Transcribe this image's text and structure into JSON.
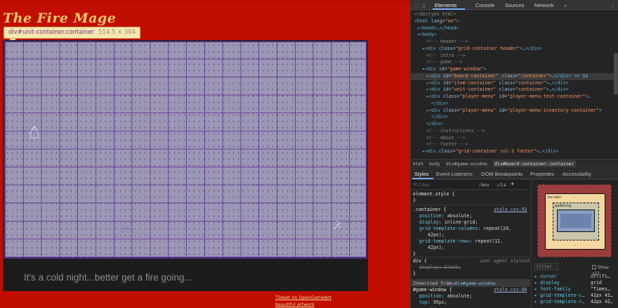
{
  "page": {
    "title": "The Fire Mage",
    "tooltip": {
      "selector": "div#unit-container.container",
      "dims": "514.5 × 304"
    },
    "message": "It's a cold night...better get a fire going...",
    "footer_left": "",
    "footer_right_line1_prefix": "",
    "footer_right_link1": "Tileset on OpenGameArt",
    "footer_right_link2": "beautiful artwork"
  },
  "devtools": {
    "tabs": [
      "Elements",
      "Console",
      "Sources",
      "Network"
    ],
    "active_tab": "Elements",
    "icons": [
      "inspect-icon",
      "device-icon",
      "more-tabs-icon",
      "kebab-icon"
    ],
    "dom": {
      "line1": "<!doctype html>",
      "line2_tag": "<html",
      "line2_attr": " lang=",
      "line2_val": "\"en\"",
      "line2_end": ">",
      "line3": "▸<head>…</head>",
      "line4": "▾<body>",
      "c_header": "<!-- header -->",
      "div1_pre": "▸<div ",
      "div1_attr": "class=",
      "div1_val": "\"grid-container header\"",
      "div1_end": ">…</div>",
      "c_intro": "<!-- intro -->",
      "c_game": "<!-- game -->",
      "gw_pre": "▾<div ",
      "gw_attr": "id=",
      "gw_val": "\"game-window\"",
      "gw_end": ">",
      "board_pre": "▸<div ",
      "board_attr1": "id=",
      "board_val1": "\"board-container\"",
      "board_attr2": " class=",
      "board_val2": "\"container\"",
      "board_end": ">…</div> == $0",
      "item_pre": "▸<div ",
      "item_attr1": "id=",
      "item_val1": "\"item-container\"",
      "item_attr2": " class=",
      "item_val2": "\"container\"",
      "item_end": ">…</div>",
      "unit_pre": "▸<div ",
      "unit_attr1": "id=",
      "unit_val1": "\"unit-container\"",
      "unit_attr2": " class=",
      "unit_val2": "\"container\"",
      "unit_end": ">…</div>",
      "pm1_pre": "▸<div ",
      "pm1_attr1": "class=",
      "pm1_val1": "\"player-menu\"",
      "pm1_attr2": " id=",
      "pm1_val2": "\"player-menu-text-container\"",
      "pm1_end": ">…",
      "close_div1": "</div>",
      "pm2_pre": "▸<div ",
      "pm2_attr1": "class=",
      "pm2_val1": "\"player-menu\"",
      "pm2_attr2": " id=",
      "pm2_val2": "\"player-menu-inventory-container\"",
      "pm2_end": ">",
      "close_div2": "</div>",
      "close_div3": "</div>",
      "c_instructions": "<!-- instructions -->",
      "c_about": "<!-- about -->",
      "c_footer": "<!-- footer -->",
      "foot_pre": "▸<div ",
      "foot_attr": "class=",
      "foot_val": "\"grid-container col-3 footer\"",
      "foot_end": ">…</div>"
    },
    "breadcrumbs": [
      "html",
      "body",
      "div#game-window",
      "div#board-container.container"
    ],
    "subtabs": [
      "Styles",
      "Event Listeners",
      "DOM Breakpoints",
      "Properties",
      "Accessibility"
    ],
    "filter": {
      "placeholder": "Filter",
      "hov": ":hov",
      "cls": ".cls",
      "plus": "+"
    },
    "styles": {
      "element_style": "element.style {",
      "close": "}",
      "container_sel": ".container {",
      "container_src": "style.css:92",
      "p1": "position",
      "v1": "absolute;",
      "p2": "display",
      "v2": "inline-grid;",
      "p3": "grid-template-columns",
      "v3": "repeat(20,",
      "v3b": "42px);",
      "p4": "grid-template-rows",
      "v4": "repeat(12,",
      "v4b": "42px);",
      "div_sel": "div {",
      "div_src": "user agent stylesheet",
      "p5": "display",
      "v5": "block;",
      "inherited_label": "Inherited from",
      "inherited_from": "div#game-window",
      "gw_sel": "#game-window {",
      "gw_src": "style.css:80",
      "p6": "position",
      "v6": "absolute;",
      "p7": "top",
      "v7": "95px;"
    },
    "box_model": {
      "border_label": "border",
      "padding_label": "padding",
      "dash": "-"
    },
    "computed": {
      "filter_placeholder": "Filter",
      "show_all": "Show all",
      "rows": [
        {
          "name": "cursor",
          "value": "url(fi…"
        },
        {
          "name": "display",
          "value": "grid"
        },
        {
          "name": "font-family",
          "value": "\"Times…"
        },
        {
          "name": "grid-template-c…",
          "value": "42px 42…"
        },
        {
          "name": "grid-template-r…",
          "value": "42px 42…"
        }
      ]
    }
  }
}
